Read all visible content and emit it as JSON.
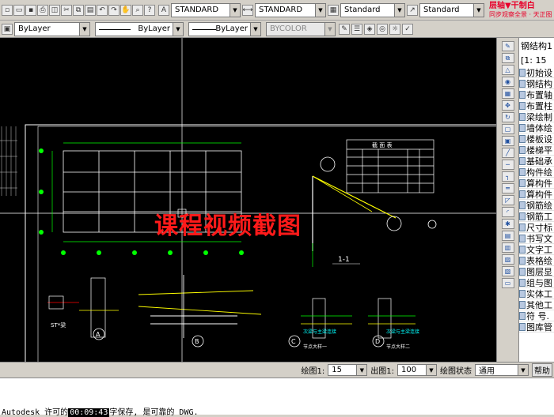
{
  "toolbar": {
    "text_style": "STANDARD",
    "dim_style": "STANDARD",
    "table_style": "Standard",
    "mleader_style": "Standard",
    "tianzheng_label": "层轴▼干制白",
    "tianzheng_sub": "同步观察全景 · 天正图"
  },
  "properties_bar": {
    "color": "ByLayer",
    "linetype": "ByLayer",
    "lineweight": "ByLayer",
    "plotstyle": "BYCOLOR"
  },
  "drawing": {
    "watermark": "课程视频截图",
    "section_label": "1-1",
    "table_title": "截 面 表",
    "detail_labels": [
      "A",
      "B",
      "C",
      "D"
    ],
    "detail_captions": [
      "次梁与主梁连接",
      "次梁与主梁连接",
      "节点大样一",
      "节点大样二"
    ],
    "marker_label": "ST*梁"
  },
  "side_menu": {
    "title": "钢结构1",
    "subtitle": "[1: 15",
    "items": [
      "初始设",
      "钢结构",
      "布置轴",
      "布置柱",
      "梁绘制",
      "墙体绘",
      "楼板设",
      "楼梯平",
      "基础承",
      "构件绘",
      "算构件",
      "算构件",
      "钢筋绘",
      "钢筋工",
      "尺寸标",
      "书写文",
      "文字工",
      "表格绘",
      "图层显",
      "组与图",
      "实体工",
      "其他工",
      "符 号.",
      "图库管"
    ]
  },
  "status": {
    "scale_label": "绘图1:",
    "scale_value": "15",
    "output_label": "出图1:",
    "output_value": "100",
    "state_label": "绘图状态",
    "state_value": "通用",
    "help_label": "帮助"
  },
  "command_line": {
    "prefix": "Autodesk 许可的",
    "timestamp": "00:09:43",
    "suffix": "字保存, 是可靠的 DWG."
  },
  "colors": {
    "canvas": "#000000",
    "watermark": "#ff1a1a",
    "drawing_white": "#ffffff",
    "drawing_green": "#00ff00",
    "drawing_yellow": "#ffff00",
    "drawing_cyan": "#00ffff"
  }
}
